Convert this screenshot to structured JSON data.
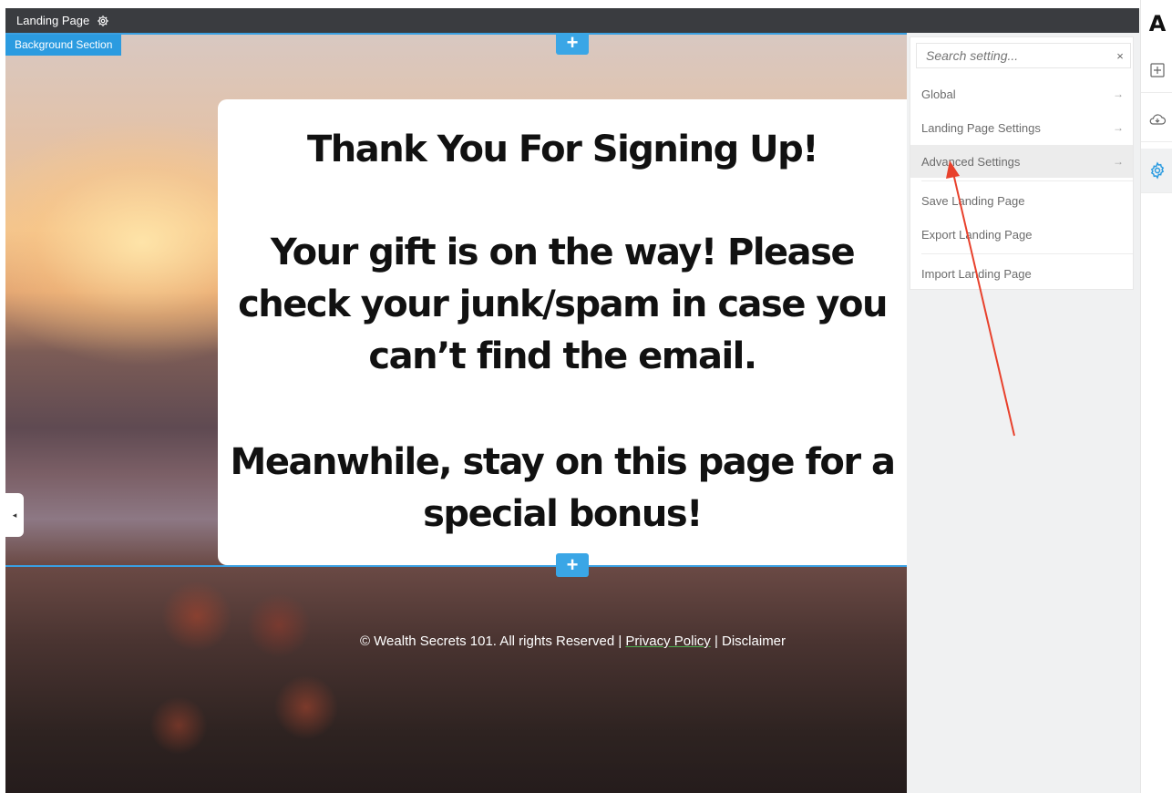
{
  "topbar": {
    "title": "Landing Page",
    "gear_icon": "gear-icon"
  },
  "canvas": {
    "section_tag": "Background Section",
    "add_button_symbol": "+",
    "left_handle_symbol": "◂",
    "card": {
      "title": "Thank You For Signing Up!",
      "gift_message": "Your gift is on the way! Please check your junk/spam in case you can’t find the email.",
      "bonus_message": "Meanwhile, stay on this page for a special bonus!"
    },
    "footer": {
      "copyright": "© Wealth Secrets 101. All rights Reserved | ",
      "privacy": "Privacy Policy",
      "separator": " | ",
      "disclaimer": "Disclaimer"
    }
  },
  "settings_panel": {
    "search_placeholder": "Search setting...",
    "clear_symbol": "×",
    "arrow_symbol": "→",
    "items": [
      {
        "label": "Global",
        "has_arrow": true
      },
      {
        "label": "Landing Page Settings",
        "has_arrow": true
      },
      {
        "label": "Advanced Settings",
        "has_arrow": true,
        "highlighted": true
      },
      {
        "label": "Save Landing Page",
        "has_arrow": false
      },
      {
        "label": "Export Landing Page",
        "has_arrow": false
      },
      {
        "label": "Import Landing Page",
        "has_arrow": false
      }
    ]
  },
  "icon_bar": {
    "logo": "A",
    "icons": [
      "add-element-icon",
      "cloud-icon",
      "settings-gear-icon"
    ],
    "active_icon": "settings-gear-icon"
  },
  "colors": {
    "accent_blue": "#2b9be0",
    "annotation_arrow": "#e8412c",
    "topbar": "#3a3c40"
  }
}
